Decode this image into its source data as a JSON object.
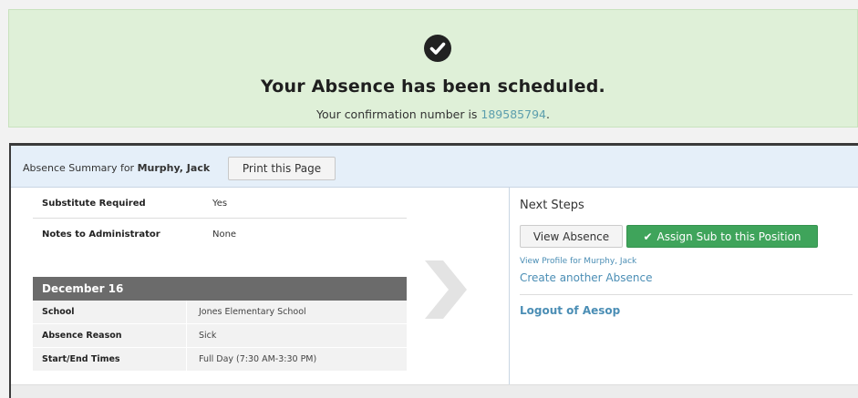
{
  "banner": {
    "title": "Your Absence has been scheduled.",
    "confirmation_prefix": "Your confirmation number is ",
    "confirmation_number": "189585794",
    "confirmation_suffix": ".",
    "icon": "check-circle-icon"
  },
  "summary": {
    "label_prefix": "Absence Summary for ",
    "employee_name": "Murphy, Jack",
    "print_button": "Print this Page"
  },
  "details": {
    "substitute_required_label": "Substitute Required",
    "substitute_required_value": "Yes",
    "notes_label": "Notes to Administrator",
    "notes_value": "None",
    "date": "December 16",
    "rows": [
      {
        "label": "School",
        "value": "Jones Elementary School"
      },
      {
        "label": "Absence Reason",
        "value": "Sick"
      },
      {
        "label": "Start/End Times",
        "value": "Full Day (7:30 AM-3:30 PM)"
      }
    ]
  },
  "next_steps": {
    "title": "Next Steps",
    "view_absence_button": "View Absence",
    "assign_sub_button": "Assign Sub to this Position",
    "view_profile_link": "View Profile for Murphy, Jack",
    "create_another_link": "Create another Absence",
    "logout_link": "Logout of Aesop"
  },
  "colors": {
    "banner_bg": "#dff0d8",
    "header_bg": "#e5eff9",
    "accent_green": "#3fa45b",
    "link_blue": "#4b8eb5"
  }
}
